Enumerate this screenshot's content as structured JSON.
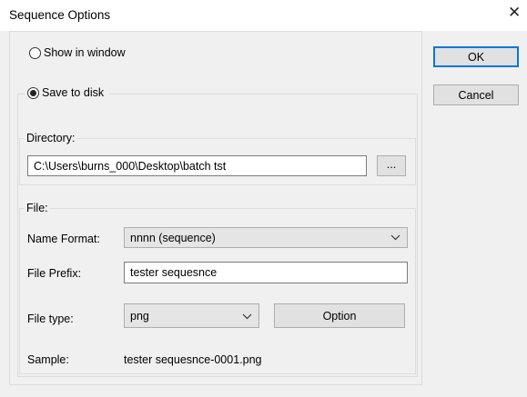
{
  "window": {
    "title": "Sequence Options",
    "close_glyph": "✕"
  },
  "buttons": {
    "ok": "OK",
    "cancel": "Cancel",
    "option": "Option",
    "browse": "..."
  },
  "output_mode": {
    "show_in_window": {
      "label": "Show in window",
      "selected": false
    },
    "save_to_disk": {
      "label": "Save to disk",
      "selected": true
    }
  },
  "directory": {
    "legend": "Directory:",
    "path": "C:\\Users\\burns_000\\Desktop\\batch tst"
  },
  "file": {
    "legend": "File:",
    "name_format_label": "Name Format:",
    "name_format_value": "nnnn (sequence)",
    "prefix_label": "File Prefix:",
    "prefix_value": "tester sequesnce",
    "type_label": "File type:",
    "type_value": "png",
    "sample_label": "Sample:",
    "sample_value": "tester sequesnce-0001.png"
  },
  "colors": {
    "accent": "#0078d7",
    "background": "#f0f0f0"
  }
}
